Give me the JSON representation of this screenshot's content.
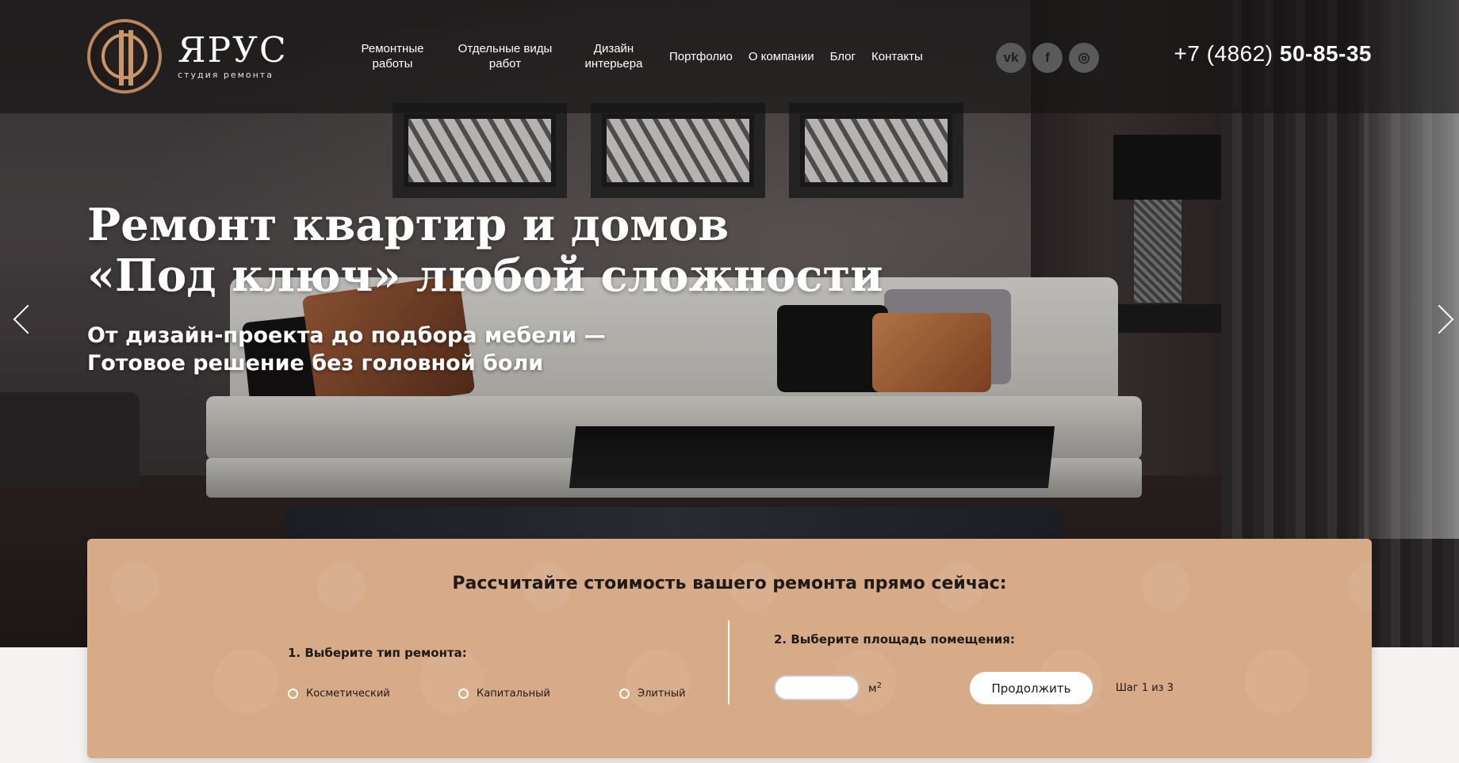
{
  "brand": {
    "name": "ЯРУС",
    "tagline": "студия ремонта",
    "accent_color": "#c8976a"
  },
  "nav": {
    "items": [
      {
        "label_line1": "Ремонтные",
        "label_line2": "работы"
      },
      {
        "label_line1": "Отдельные виды",
        "label_line2": "работ"
      },
      {
        "label_line1": "Дизайн",
        "label_line2": "интерьера"
      },
      {
        "label": "Портфолио"
      },
      {
        "label": "О компании"
      },
      {
        "label": "Блог"
      },
      {
        "label": "Контакты"
      }
    ]
  },
  "social": {
    "vk": {
      "icon": "vk-icon",
      "glyph": "vk"
    },
    "facebook": {
      "icon": "facebook-icon",
      "glyph": "f"
    },
    "instagram": {
      "icon": "instagram-icon",
      "glyph": "◎"
    }
  },
  "phone": {
    "prefix": "+7 (4862) ",
    "number": "50-85-35"
  },
  "hero": {
    "title_line1": "Ремонт квартир и домов",
    "title_line2": "«Под ключ» любой сложности",
    "subtitle_line1": "От дизайн-проекта до подбора мебели —",
    "subtitle_line2": "Готовое решение без головной боли",
    "prev_icon": "chevron-left-icon",
    "next_icon": "chevron-right-icon"
  },
  "calculator": {
    "title": "Рассчитайте стоимость вашего ремонта прямо сейчас:",
    "step1_label": "1. Выберите тип ремонта:",
    "options": [
      "Косметический",
      "Капитальный",
      "Элитный"
    ],
    "step2_label": "2. Выберите площадь помещения:",
    "area_value": "",
    "unit": "м",
    "unit_sup": "2",
    "continue_label": "Продолжить",
    "step_count": "Шаг 1 из 3",
    "panel_color": "#d7ab88"
  }
}
